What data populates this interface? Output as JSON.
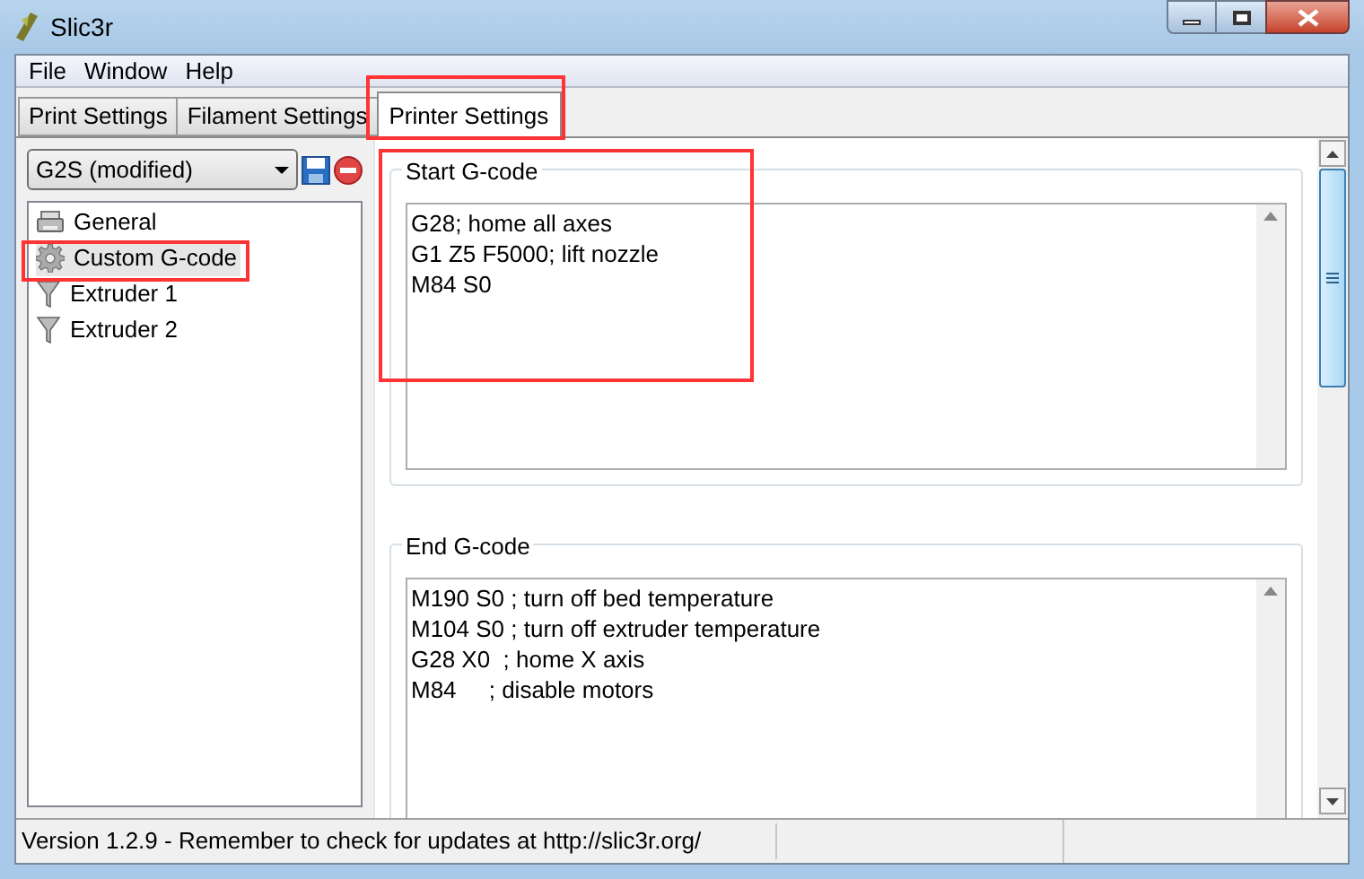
{
  "window": {
    "title": "Slic3r"
  },
  "menu": [
    "File",
    "Window",
    "Help"
  ],
  "tabs": [
    {
      "label": "Print Settings",
      "selected": false
    },
    {
      "label": "Filament Settings",
      "selected": false
    },
    {
      "label": "Printer Settings",
      "selected": true
    }
  ],
  "preset": {
    "value": "G2S (modified)"
  },
  "tree": [
    {
      "label": "General",
      "kind": "printer",
      "selected": false
    },
    {
      "label": "Custom G-code",
      "kind": "gear",
      "selected": true
    },
    {
      "label": "Extruder 1",
      "kind": "funnel",
      "selected": false
    },
    {
      "label": "Extruder 2",
      "kind": "funnel",
      "selected": false
    }
  ],
  "groups": [
    {
      "title": "Start G-code",
      "lines": [
        "G28; home all axes",
        "G1 Z5 F5000; lift nozzle",
        "M84 S0"
      ]
    },
    {
      "title": "End G-code",
      "lines": [
        "M190 S0 ; turn off bed temperature",
        "M104 S0 ; turn off extruder temperature",
        "G28 X0  ; home X axis",
        "M84     ; disable motors"
      ]
    }
  ],
  "status_bar": "Version 1.2.9 - Remember to check for updates at http://slic3r.org/"
}
